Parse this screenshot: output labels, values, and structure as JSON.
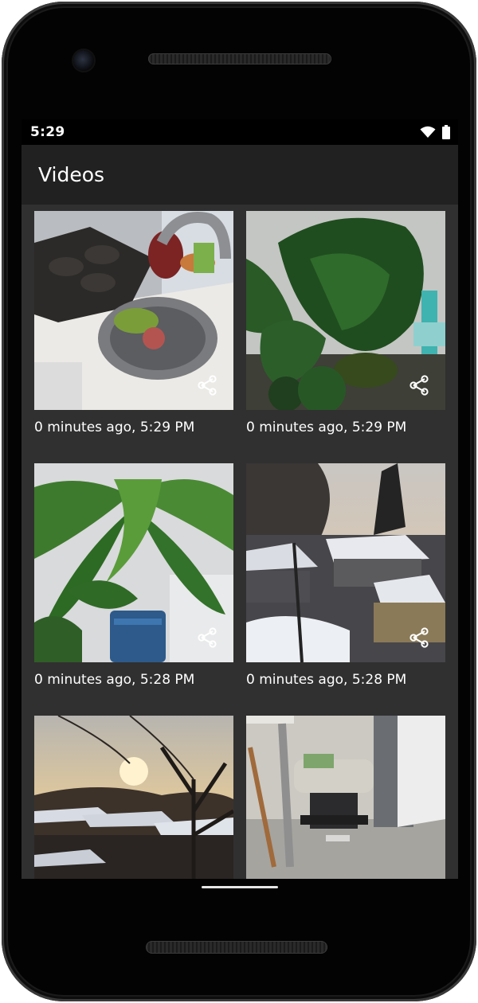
{
  "status_bar": {
    "time": "5:29",
    "icons": [
      "wifi-icon",
      "battery-icon"
    ]
  },
  "app_bar": {
    "title": "Videos"
  },
  "videos": [
    {
      "caption": "0 minutes ago, 5:29 PM",
      "thumbnail": "toy kitchen sink with play food"
    },
    {
      "caption": "0 minutes ago, 5:29 PM",
      "thumbnail": "monstera plant"
    },
    {
      "caption": "0 minutes ago, 5:28 PM",
      "thumbnail": "palm houseplant"
    },
    {
      "caption": "0 minutes ago, 5:28 PM",
      "thumbnail": "snowy backyard at dusk"
    },
    {
      "caption": "",
      "thumbnail": "sunset over rooftops with bare tree"
    },
    {
      "caption": "",
      "thumbnail": "room with ottoman and door"
    }
  ],
  "colors": {
    "screen_background": "#303030",
    "app_bar_background": "#212121",
    "text": "#ffffff"
  }
}
